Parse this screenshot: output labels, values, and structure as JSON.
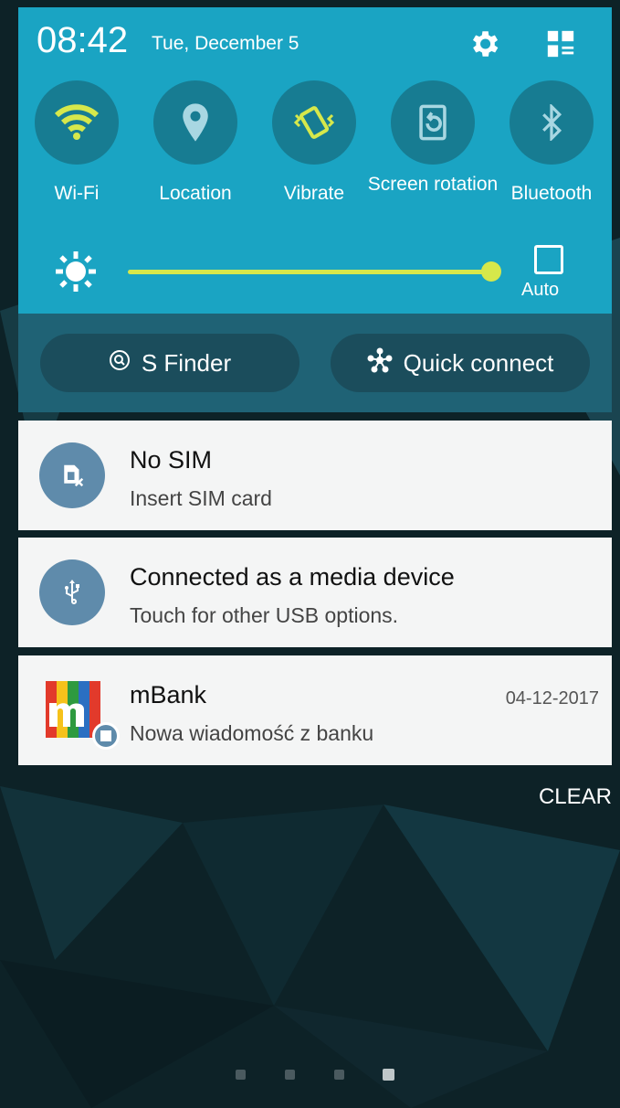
{
  "status": {
    "time": "08:42",
    "date": "Tue, December 5"
  },
  "quick_settings": {
    "tiles": [
      {
        "label": "Wi-Fi",
        "icon": "wifi-icon",
        "active": true
      },
      {
        "label": "Location",
        "icon": "location-icon",
        "active": false
      },
      {
        "label": "Vibrate",
        "icon": "vibrate-icon",
        "active": true
      },
      {
        "label": "Screen rotation",
        "icon": "screen-rotation-icon",
        "active": false
      },
      {
        "label": "Bluetooth",
        "icon": "bluetooth-icon",
        "active": false
      }
    ],
    "brightness": {
      "level": 1.0,
      "auto_label": "Auto",
      "auto_checked": false
    }
  },
  "actions": {
    "s_finder": "S Finder",
    "quick_connect": "Quick connect"
  },
  "notifications": [
    {
      "title": "No SIM",
      "subtitle": "Insert SIM card",
      "icon": "sim-card-icon",
      "time": ""
    },
    {
      "title": "Connected as a media device",
      "subtitle": "Touch for other USB options.",
      "icon": "usb-icon",
      "time": ""
    },
    {
      "title": "mBank",
      "subtitle": "Nowa wiadomość z banku",
      "icon": "mbank-logo-icon",
      "time": "04-12-2017"
    }
  ],
  "clear_label": "CLEAR",
  "pages": {
    "count": 4,
    "current": 4
  },
  "colors": {
    "panel": "#1aa4c3",
    "accent": "#d6e84b",
    "tile_bg": "#177c92",
    "card": "#f4f5f5"
  }
}
